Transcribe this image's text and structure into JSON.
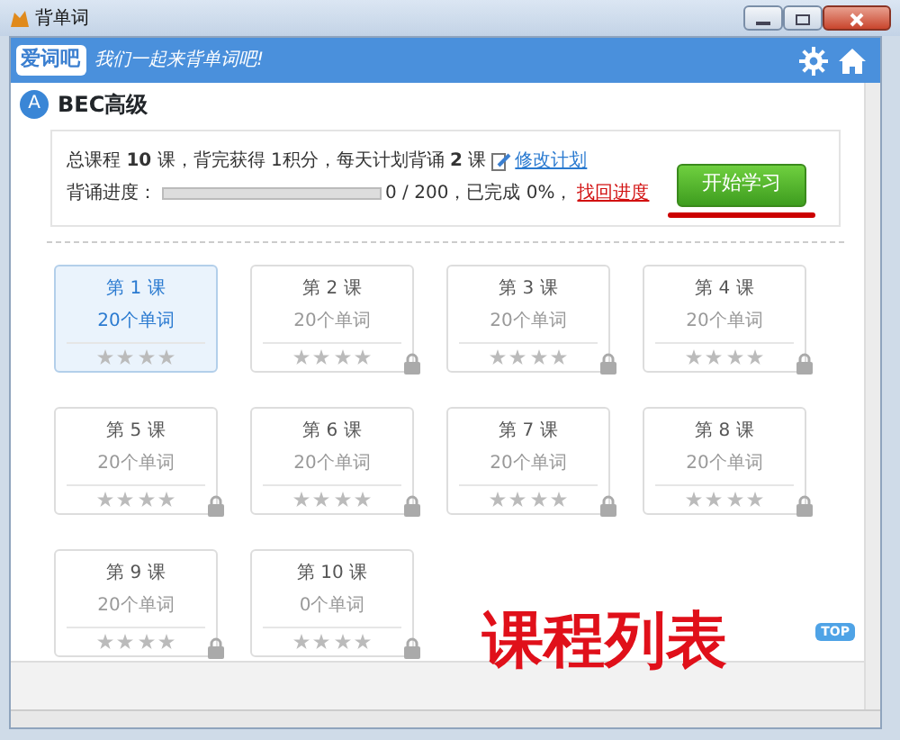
{
  "window": {
    "title": "背单词"
  },
  "header": {
    "logo": "爱词吧",
    "slogan": "我们一起来背单词吧!"
  },
  "book": {
    "badge": "A",
    "title": "BEC高级"
  },
  "plan": {
    "summary": "总课程 **10** 课，背完获得 1积分，每天计划背诵 **2** 课",
    "edit_link": "修改计划",
    "progress_label": "背诵进度：",
    "level": 0,
    "progress_text": "0 / 200，已完成 0%，",
    "recover_link": "找回进度",
    "start_button": "开始学习"
  },
  "lessons": [
    {
      "title": "第 1 课",
      "words": "20个单词",
      "stars": 0,
      "locked": false,
      "selected": true
    },
    {
      "title": "第 2 课",
      "words": "20个单词",
      "stars": 0,
      "locked": true,
      "selected": false
    },
    {
      "title": "第 3 课",
      "words": "20个单词",
      "stars": 0,
      "locked": true,
      "selected": false
    },
    {
      "title": "第 4 课",
      "words": "20个单词",
      "stars": 0,
      "locked": true,
      "selected": false
    },
    {
      "title": "第 5 课",
      "words": "20个单词",
      "stars": 0,
      "locked": true,
      "selected": false
    },
    {
      "title": "第 6 课",
      "words": "20个单词",
      "stars": 0,
      "locked": true,
      "selected": false
    },
    {
      "title": "第 7 课",
      "words": "20个单词",
      "stars": 0,
      "locked": true,
      "selected": false
    },
    {
      "title": "第 8 课",
      "words": "20个单词",
      "stars": 0,
      "locked": true,
      "selected": false
    },
    {
      "title": "第 9 课",
      "words": "20个单词",
      "stars": 0,
      "locked": true,
      "selected": false
    },
    {
      "title": "第 10 课",
      "words": "0个单词",
      "stars": 0,
      "locked": true,
      "selected": false
    }
  ],
  "top_button": "TOP",
  "annotation": "课程列表"
}
